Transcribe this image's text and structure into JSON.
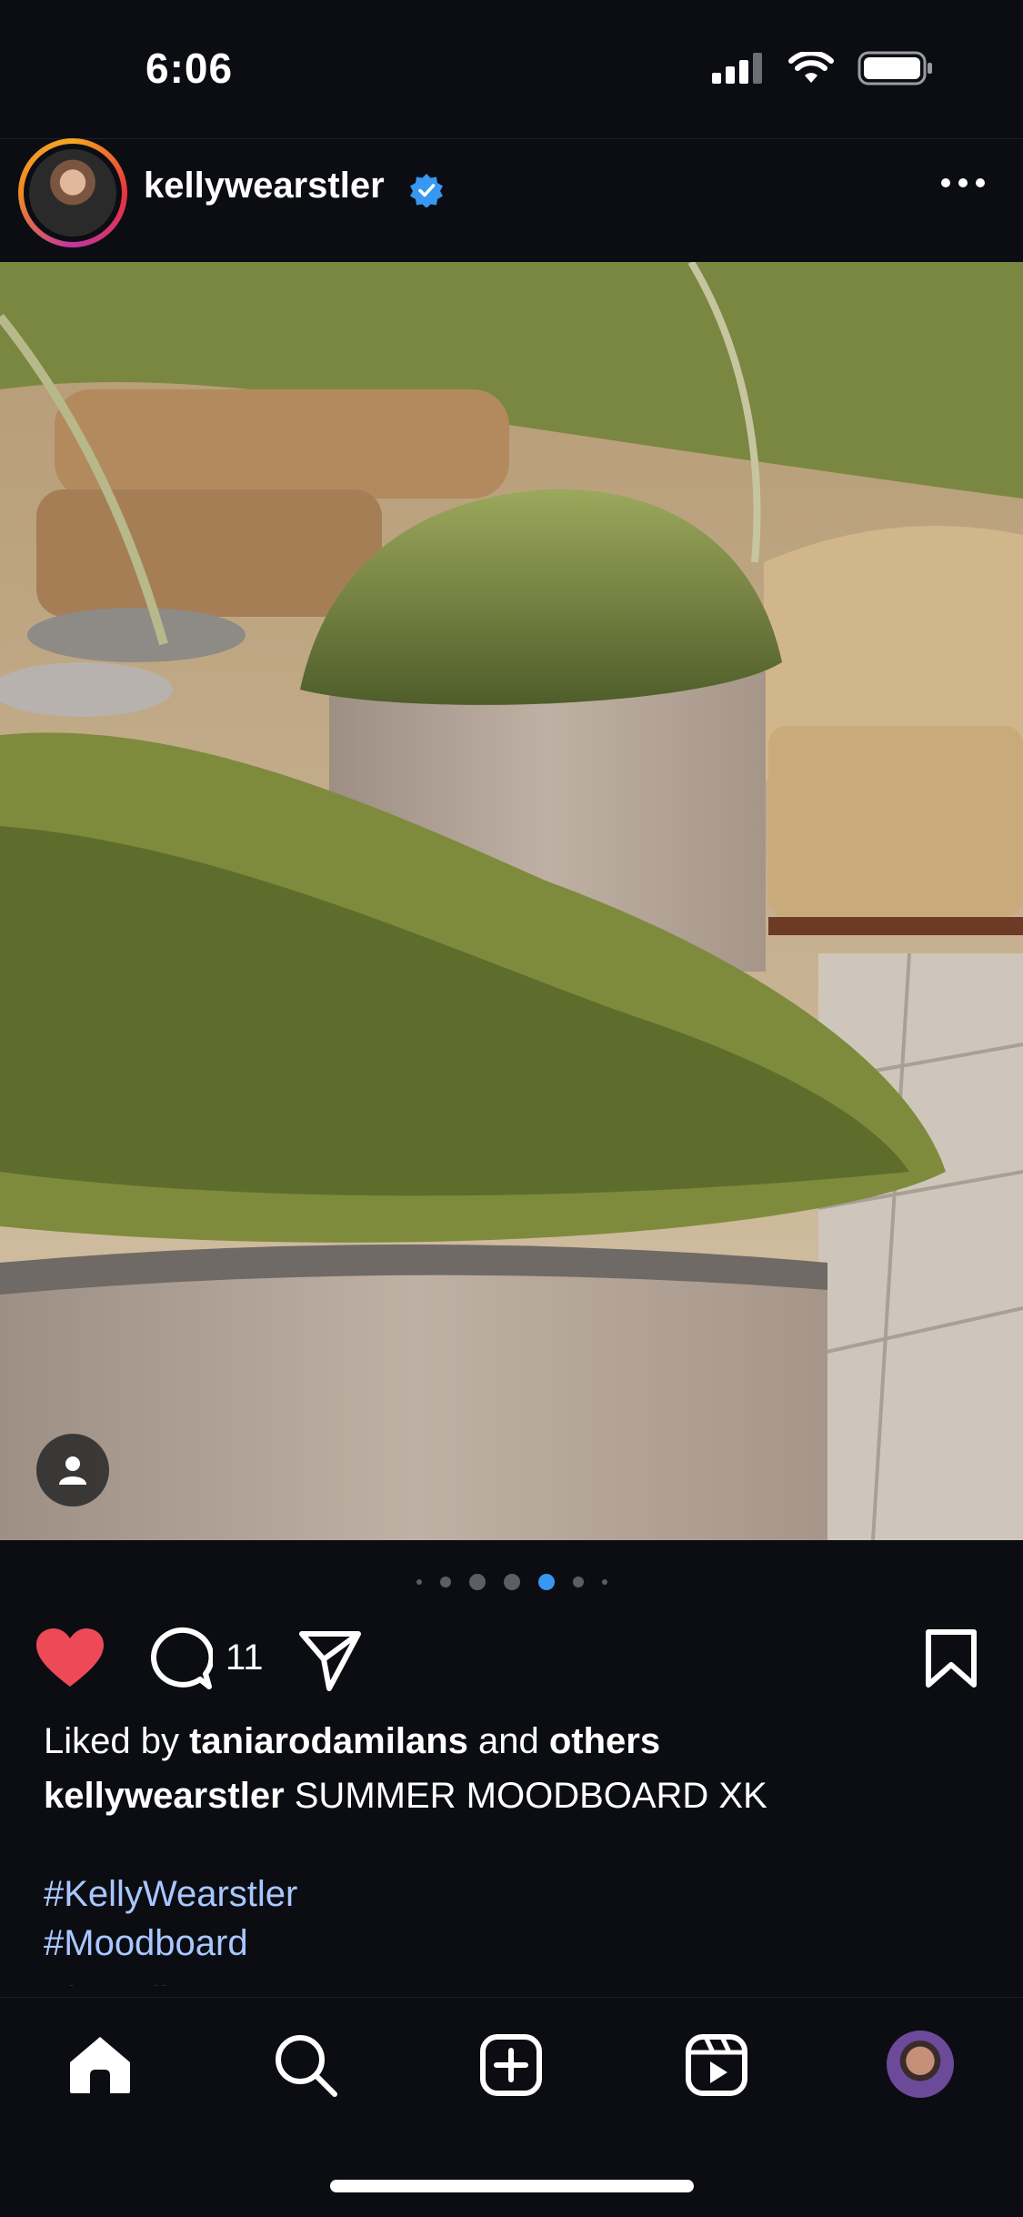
{
  "status_bar": {
    "time": "6:06"
  },
  "post": {
    "username": "kellywearstler",
    "verified": true,
    "carousel": {
      "total": 7,
      "active_index": 4
    },
    "comment_count": "11",
    "liked": true,
    "likes_line": {
      "prefix": "Liked by ",
      "user": "taniarodamilans",
      "middle": " and ",
      "suffix": "others"
    },
    "caption": {
      "user": "kellywearstler",
      "text": " SUMMER MOODBOARD XK"
    },
    "hashtags": [
      "#KellyWearstler",
      "#Moodboard"
    ],
    "view_all": "View all comments"
  },
  "tabs": [
    "home",
    "search",
    "create",
    "reels",
    "profile"
  ],
  "colors": {
    "background": "#0b0d13",
    "heart": "#ed4956",
    "verified": "#3897f0",
    "hashtag": "#a9c7ff",
    "dot_active": "#3897f0"
  }
}
